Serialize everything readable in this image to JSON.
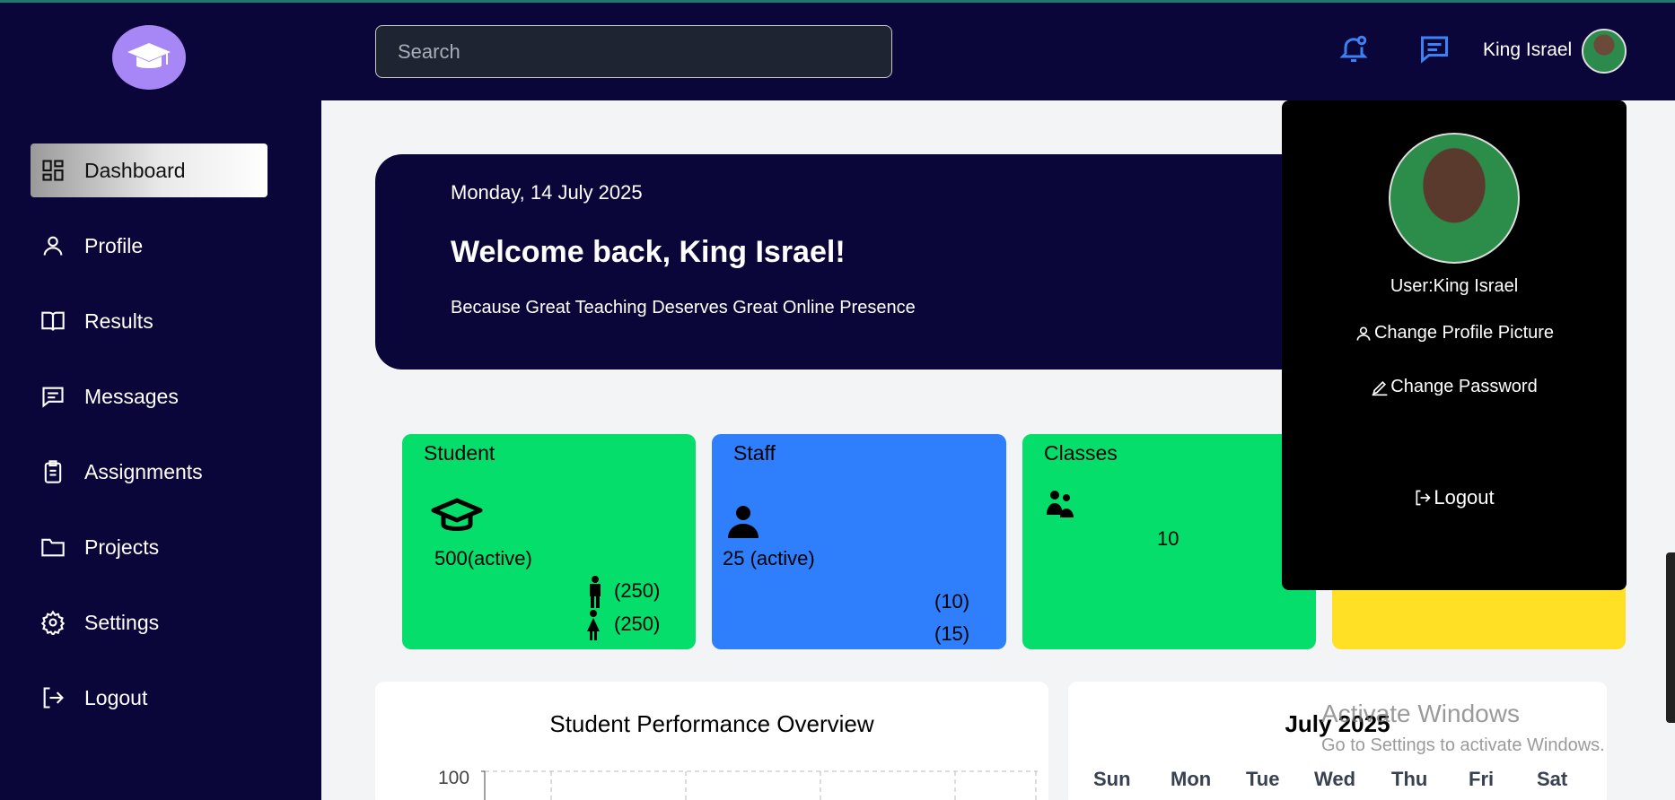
{
  "header": {
    "search_placeholder": "Search",
    "username": "King Israel",
    "icons": [
      "bell-icon",
      "message-icon"
    ],
    "accent": "#3b82f6"
  },
  "sidebar": {
    "items": [
      {
        "label": "Dashboard",
        "icon": "dashboard-icon",
        "active": true
      },
      {
        "label": "Profile",
        "icon": "user-icon"
      },
      {
        "label": "Results",
        "icon": "book-icon"
      },
      {
        "label": "Messages",
        "icon": "message-icon"
      },
      {
        "label": "Assignments",
        "icon": "clipboard-icon"
      },
      {
        "label": "Projects",
        "icon": "folder-icon"
      },
      {
        "label": "Settings",
        "icon": "gear-icon"
      },
      {
        "label": "Logout",
        "icon": "logout-icon"
      }
    ]
  },
  "banner": {
    "date": "Monday, 14 July 2025",
    "welcome": "Welcome back, King Israel!",
    "tagline": "Because Great Teaching Deserves Great Online Presence"
  },
  "cards": {
    "student": {
      "title": "Student",
      "active": "500(active)",
      "male": "(250)",
      "female": "(250)",
      "color": "#05de6a"
    },
    "staff": {
      "title": "Staff",
      "active": "25 (active)",
      "count_a": "(10)",
      "count_b": "(15)",
      "color": "#2f7ffc"
    },
    "classes": {
      "title": "Classes",
      "count": "10",
      "color": "#05de6a"
    },
    "fourth": {
      "color": "#ffe025"
    }
  },
  "chart_panel": {
    "title": "Student Performance Overview",
    "y_tick": "100"
  },
  "calendar": {
    "title": "July 2025",
    "days": [
      "Sun",
      "Mon",
      "Tue",
      "Wed",
      "Thu",
      "Fri",
      "Sat"
    ]
  },
  "dropdown": {
    "user": "User:King Israel",
    "change_picture": "Change Profile Picture",
    "change_password": "Change Password",
    "logout": "Logout"
  },
  "watermark": {
    "line1": "Activate Windows",
    "line2": "Go to Settings to activate Windows."
  }
}
